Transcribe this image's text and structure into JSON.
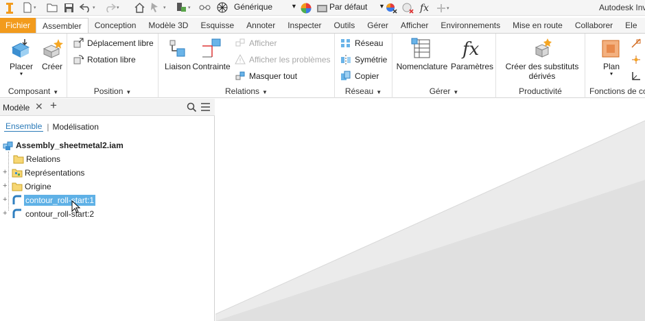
{
  "app": {
    "title": "Autodesk Inv"
  },
  "quick_access": {
    "appearance_select": "Générique",
    "view_rep": "Par défaut"
  },
  "tabs": [
    {
      "label": "Fichier"
    },
    {
      "label": "Assembler"
    },
    {
      "label": "Conception"
    },
    {
      "label": "Modèle 3D"
    },
    {
      "label": "Esquisse"
    },
    {
      "label": "Annoter"
    },
    {
      "label": "Inspecter"
    },
    {
      "label": "Outils"
    },
    {
      "label": "Gérer"
    },
    {
      "label": "Afficher"
    },
    {
      "label": "Environnements"
    },
    {
      "label": "Mise en route"
    },
    {
      "label": "Collaborer"
    },
    {
      "label": "Ele"
    }
  ],
  "ribbon": {
    "composant": {
      "title": "Composant",
      "placer": "Placer",
      "creer": "Créer"
    },
    "position": {
      "title": "Position",
      "deplacement": "Déplacement libre",
      "rotation": "Rotation libre"
    },
    "relations": {
      "title": "Relations",
      "liaison": "Liaison",
      "contrainte": "Contrainte",
      "afficher": "Afficher",
      "afficher_problemes": "Afficher les problèmes",
      "masquer_tout": "Masquer tout"
    },
    "reseau": {
      "title": "Réseau",
      "reseau": "Réseau",
      "symetrie": "Symétrie",
      "copier": "Copier"
    },
    "gerer": {
      "title": "Gérer",
      "nomenclature": "Nomenclature",
      "parametres": "Paramètres"
    },
    "productivite": {
      "title": "Productivité",
      "substituts_l1": "Créer des substituts",
      "substituts_l2": "dérivés"
    },
    "fonctions": {
      "title": "Fonctions de co",
      "plan": "Plan"
    }
  },
  "browser": {
    "title": "Modèle",
    "tab_ensemble": "Ensemble",
    "tab_modelisation": "Modélisation",
    "root": "Assembly_sheetmetal2.iam",
    "items": [
      {
        "label": "Relations"
      },
      {
        "label": "Représentations"
      },
      {
        "label": "Origine"
      },
      {
        "label": "contour_roll-start:1"
      },
      {
        "label": "contour_roll-start:2"
      }
    ]
  }
}
